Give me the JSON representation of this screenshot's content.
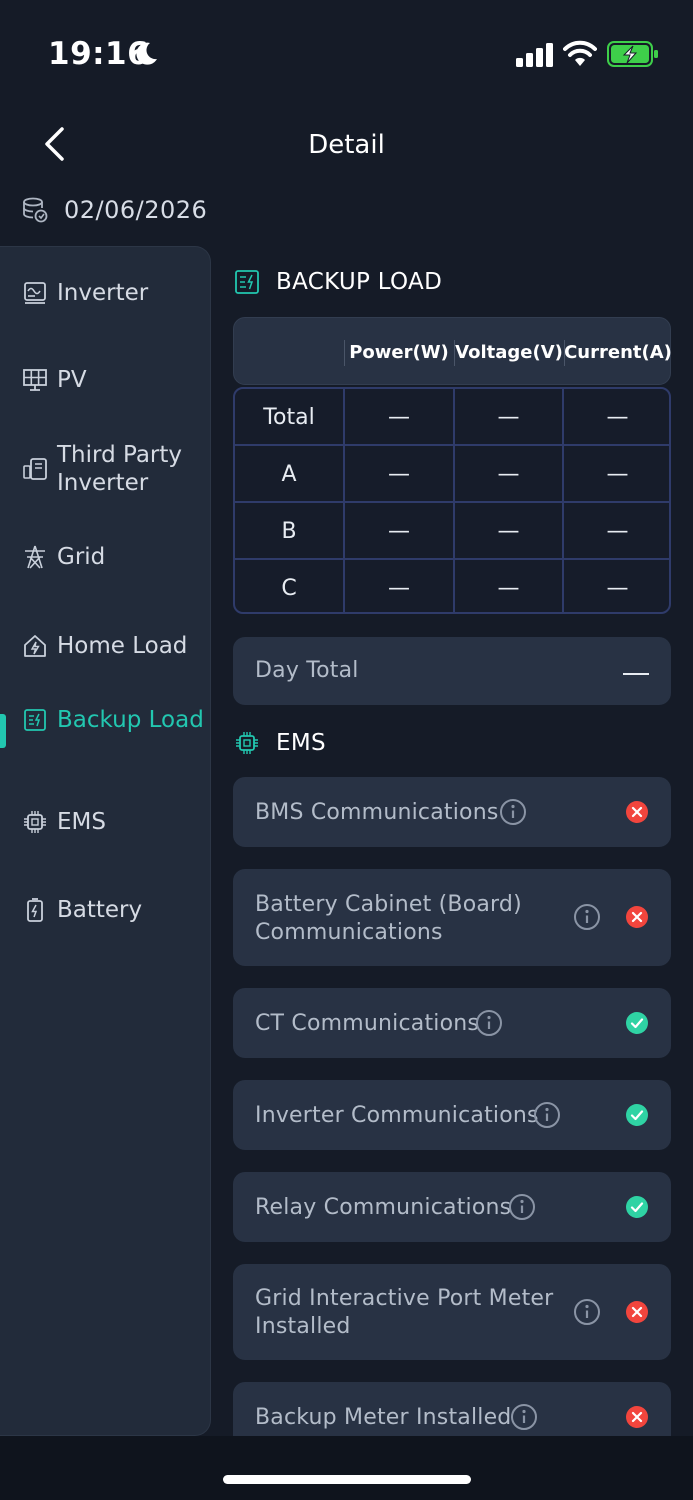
{
  "status_bar": {
    "time": "19:16"
  },
  "header": {
    "title": "Detail"
  },
  "date": "02/06/2026",
  "sidebar": {
    "items": [
      {
        "label": "Inverter",
        "icon": "inverter-icon"
      },
      {
        "label": "PV",
        "icon": "solar-panel-icon"
      },
      {
        "label": "Third Party Inverter",
        "icon": "third-party-inverter-icon"
      },
      {
        "label": "Grid",
        "icon": "grid-tower-icon"
      },
      {
        "label": "Home Load",
        "icon": "home-load-icon"
      },
      {
        "label": "Backup Load",
        "icon": "backup-load-icon",
        "active": true
      },
      {
        "label": "EMS",
        "icon": "ems-chip-icon"
      },
      {
        "label": "Battery",
        "icon": "battery-icon"
      }
    ]
  },
  "backup_load": {
    "title": "BACKUP LOAD",
    "columns": [
      "",
      "Power(W)",
      "Voltage(V)",
      "Current(A)"
    ],
    "rows": [
      {
        "name": "Total",
        "power": "—",
        "voltage": "—",
        "current": "—"
      },
      {
        "name": "A",
        "power": "—",
        "voltage": "—",
        "current": "—"
      },
      {
        "name": "B",
        "power": "—",
        "voltage": "—",
        "current": "—"
      },
      {
        "name": "C",
        "power": "—",
        "voltage": "—",
        "current": "—"
      }
    ],
    "day_total_label": "Day Total"
  },
  "ems": {
    "title": "EMS",
    "items": [
      {
        "label": "BMS Communications",
        "status": "error"
      },
      {
        "label": "Battery Cabinet (Board) Communications",
        "status": "error"
      },
      {
        "label": "CT Communications",
        "status": "ok"
      },
      {
        "label": "Inverter Communications",
        "status": "ok"
      },
      {
        "label": "Relay Communications",
        "status": "ok"
      },
      {
        "label": "Grid Interactive Port Meter Installed",
        "status": "error"
      },
      {
        "label": "Backup Meter Installed",
        "status": "error"
      }
    ]
  },
  "colors": {
    "accent": "#22c7b0",
    "ok": "#2fd3a4",
    "error": "#f2453d",
    "card": "#283244",
    "background": "#151b27"
  }
}
